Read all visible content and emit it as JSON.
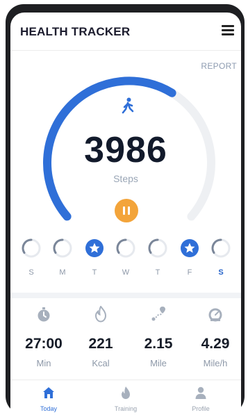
{
  "header": {
    "title": "HEALTH TRACKER"
  },
  "report_label": "REPORT",
  "steps": {
    "value": "3986",
    "label": "Steps",
    "goal_progress": 0.62
  },
  "week": [
    {
      "letter": "S",
      "status": "partial",
      "today": false
    },
    {
      "letter": "M",
      "status": "partial",
      "today": false
    },
    {
      "letter": "T",
      "status": "complete",
      "today": false
    },
    {
      "letter": "W",
      "status": "partial",
      "today": false
    },
    {
      "letter": "T",
      "status": "partial",
      "today": false
    },
    {
      "letter": "F",
      "status": "complete",
      "today": false
    },
    {
      "letter": "S",
      "status": "partial",
      "today": true
    }
  ],
  "stats": [
    {
      "icon": "stopwatch-icon",
      "value": "27:00",
      "unit": "Min"
    },
    {
      "icon": "flame-icon",
      "value": "221",
      "unit": "Kcal"
    },
    {
      "icon": "route-icon",
      "value": "2.15",
      "unit": "Mile"
    },
    {
      "icon": "speedometer-icon",
      "value": "4.29",
      "unit": "Mile/h"
    }
  ],
  "tabs": [
    {
      "label": "Today",
      "icon": "home-icon",
      "active": true
    },
    {
      "label": "Training",
      "icon": "flame-icon",
      "active": false
    },
    {
      "label": "Profile",
      "icon": "person-icon",
      "active": false
    }
  ],
  "colors": {
    "accent": "#2f6fd8",
    "track": "#eef0f3",
    "pause": "#f3a43a",
    "icon_gray": "#a7b0bd"
  }
}
